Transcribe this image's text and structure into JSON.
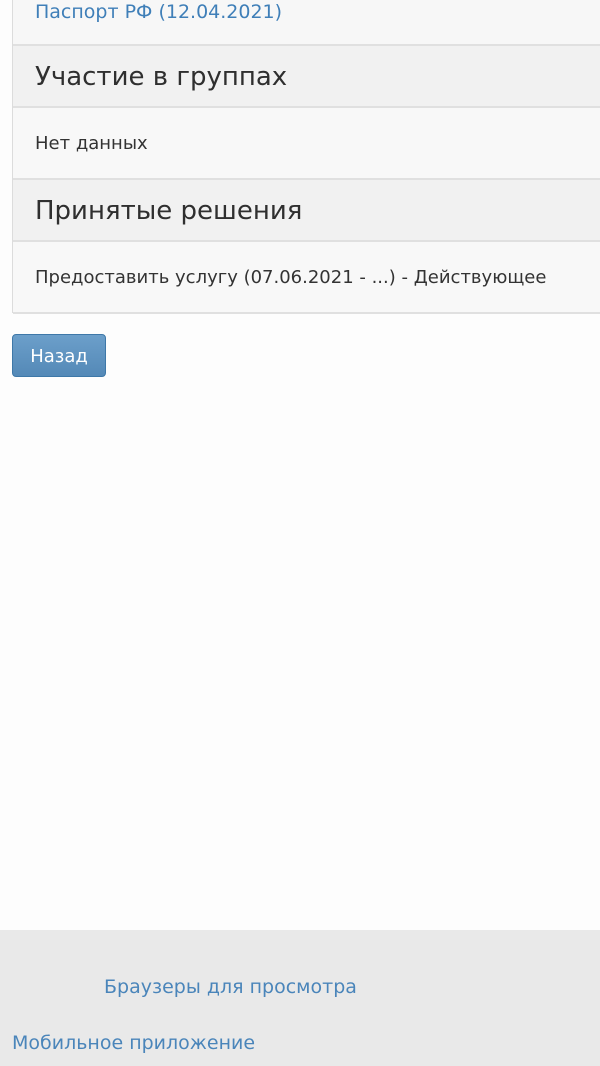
{
  "document": {
    "link_text": "Паспорт РФ (12.04.2021)"
  },
  "groups": {
    "title": "Участие в группах",
    "content": "Нет данных"
  },
  "decisions": {
    "title": "Принятые решения",
    "content": "Предоставить услугу (07.06.2021 - ...) - Действующее"
  },
  "actions": {
    "back_label": "Назад"
  },
  "footer": {
    "browsers_link": "Браузеры для просмотра",
    "mobile_app_link": "Мобильное приложение"
  },
  "colors": {
    "link": "#3f7fb8",
    "button": "#5b8fbd",
    "footer_bg": "#e9e9e9"
  }
}
